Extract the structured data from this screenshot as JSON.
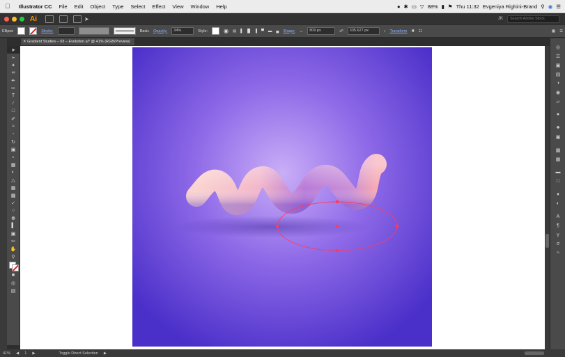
{
  "menubar": {
    "app_name": "Illustrator CC",
    "items": [
      "File",
      "Edit",
      "Object",
      "Type",
      "Select",
      "Effect",
      "View",
      "Window",
      "Help"
    ],
    "battery": "88%",
    "clock": "Thu 11:32",
    "user": "Evgeniya Righini-Brand"
  },
  "apptitle": {
    "logo": "Ai",
    "workspace_switcher": "JK",
    "search_placeholder": "Search Adobe Stock"
  },
  "control": {
    "selection": "Ellipse",
    "stroke_label": "Stroke:",
    "stroke_value": "",
    "brush": "Basic",
    "opacity_label": "Opacity:",
    "opacity_value": "34%",
    "style_label": "Style:",
    "shape_label": "Shape:",
    "width_value": "809 px",
    "height_value": "335.627 px",
    "transform_label": "Transform"
  },
  "document": {
    "tab": "Gradient Studies – 03 – Evolution.ai* @ 41% (RGB/Preview)"
  },
  "statusbar": {
    "zoom": "41%",
    "artboard": "1",
    "status": "Toggle Direct Selection"
  },
  "colors": {
    "bg_dark": "#2e2e2e",
    "panel": "#4a4a4a",
    "artboard_center": "#c4a8f5",
    "artboard_edge": "#4a2fc9",
    "shape_pink": "#f5b6c4",
    "shape_purple": "#8a4fd0",
    "selection_red": "#ff3b5c"
  },
  "tools": [
    "selection-tool",
    "direct-selection-tool",
    "magic-wand-tool",
    "lasso-tool",
    "pen-tool",
    "curvature-tool",
    "type-tool",
    "line-tool",
    "rectangle-tool",
    "paintbrush-tool",
    "shaper-tool",
    "eraser-tool",
    "rotate-tool",
    "scale-tool",
    "width-tool",
    "free-transform-tool",
    "shape-builder-tool",
    "perspective-grid-tool",
    "mesh-tool",
    "gradient-tool",
    "eyedropper-tool",
    "blend-tool",
    "symbol-sprayer-tool",
    "column-graph-tool",
    "artboard-tool",
    "slice-tool",
    "hand-tool",
    "zoom-tool"
  ]
}
